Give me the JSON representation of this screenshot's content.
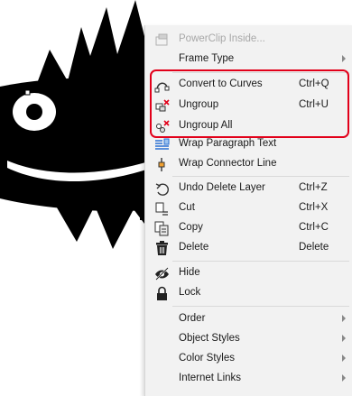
{
  "menu": {
    "items": [
      {
        "label": "PowerClip Inside...",
        "shortcut": "",
        "submenu": false,
        "disabled": true,
        "icon": "powerclip-icon"
      },
      {
        "label": "Frame Type",
        "shortcut": "",
        "submenu": true,
        "disabled": false,
        "icon": ""
      },
      {
        "label": "Convert to Curves",
        "shortcut": "Ctrl+Q",
        "submenu": false,
        "disabled": false,
        "icon": "convert-curves-icon"
      },
      {
        "label": "Ungroup",
        "shortcut": "Ctrl+U",
        "submenu": false,
        "disabled": false,
        "icon": "ungroup-icon"
      },
      {
        "label": "Ungroup All",
        "shortcut": "",
        "submenu": false,
        "disabled": false,
        "icon": "ungroup-all-icon"
      },
      {
        "label": "Wrap Paragraph Text",
        "shortcut": "",
        "submenu": false,
        "disabled": false,
        "icon": "wrap-paragraph-icon"
      },
      {
        "label": "Wrap Connector Line",
        "shortcut": "",
        "submenu": false,
        "disabled": false,
        "icon": "wrap-connector-icon"
      },
      {
        "label": "Undo Delete Layer",
        "shortcut": "Ctrl+Z",
        "submenu": false,
        "disabled": false,
        "icon": "undo-icon"
      },
      {
        "label": "Cut",
        "shortcut": "Ctrl+X",
        "submenu": false,
        "disabled": false,
        "icon": "cut-icon"
      },
      {
        "label": "Copy",
        "shortcut": "Ctrl+C",
        "submenu": false,
        "disabled": false,
        "icon": "copy-icon"
      },
      {
        "label": "Delete",
        "shortcut": "Delete",
        "submenu": false,
        "disabled": false,
        "icon": "trash-icon"
      },
      {
        "label": "Hide",
        "shortcut": "",
        "submenu": false,
        "disabled": false,
        "icon": "hide-eye-icon"
      },
      {
        "label": "Lock",
        "shortcut": "",
        "submenu": false,
        "disabled": false,
        "icon": "lock-icon"
      },
      {
        "label": "Order",
        "shortcut": "",
        "submenu": true,
        "disabled": false,
        "icon": ""
      },
      {
        "label": "Object Styles",
        "shortcut": "",
        "submenu": true,
        "disabled": false,
        "icon": ""
      },
      {
        "label": "Color Styles",
        "shortcut": "",
        "submenu": true,
        "disabled": false,
        "icon": ""
      },
      {
        "label": "Internet Links",
        "shortcut": "",
        "submenu": true,
        "disabled": false,
        "icon": ""
      }
    ]
  },
  "colors": {
    "highlight_box": "#e2001a",
    "menu_bg": "#f2f2f2",
    "artwork": "#000000"
  }
}
